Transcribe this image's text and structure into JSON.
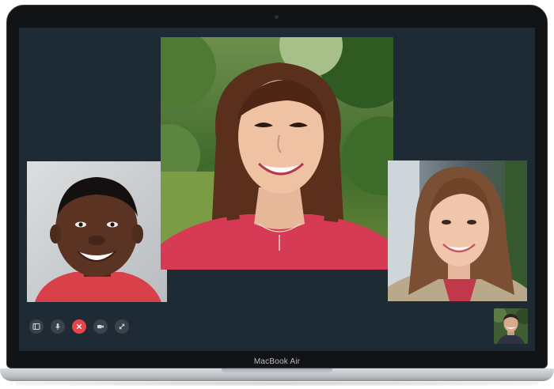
{
  "device": {
    "brand_label": "MacBook Air"
  },
  "call": {
    "participants": [
      {
        "id": "left",
        "tile": "participant-left"
      },
      {
        "id": "center",
        "tile": "participant-center"
      },
      {
        "id": "right",
        "tile": "participant-right"
      }
    ],
    "self_view": "self-view"
  },
  "controls": [
    {
      "name": "sidebar-toggle-button",
      "icon": "sidebar-icon"
    },
    {
      "name": "mute-button",
      "icon": "microphone-icon"
    },
    {
      "name": "end-call-button",
      "icon": "close-icon"
    },
    {
      "name": "camera-button",
      "icon": "video-camera-icon"
    },
    {
      "name": "fullscreen-button",
      "icon": "expand-icon"
    }
  ],
  "colors": {
    "screen_background": "#1e2a34",
    "control_background": "#3a434d",
    "end_call": "#e8424a",
    "bezel": "#121315"
  }
}
